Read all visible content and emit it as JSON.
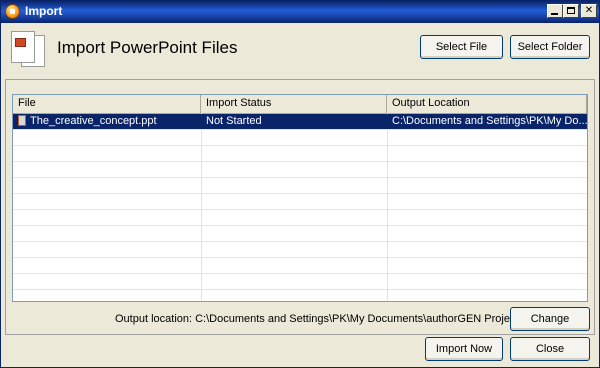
{
  "window": {
    "title": "Import"
  },
  "header": {
    "title": "Import PowerPoint Files",
    "select_file_label": "Select File",
    "select_folder_label": "Select Folder"
  },
  "table": {
    "columns": [
      "File",
      "Import Status",
      "Output Location"
    ],
    "rows": [
      {
        "file": "The_creative_concept.ppt",
        "status": "Not Started",
        "output": "C:\\Documents and Settings\\PK\\My Do..."
      }
    ]
  },
  "footer": {
    "output_location": "Output location: C:\\Documents and Settings\\PK\\My Documents\\authorGEN Projects",
    "change_label": "Change",
    "import_label": "Import Now",
    "close_label": "Close"
  },
  "colors": {
    "selection": "#0a246a",
    "titlebar": "#245edb",
    "face": "#ece9d8"
  }
}
